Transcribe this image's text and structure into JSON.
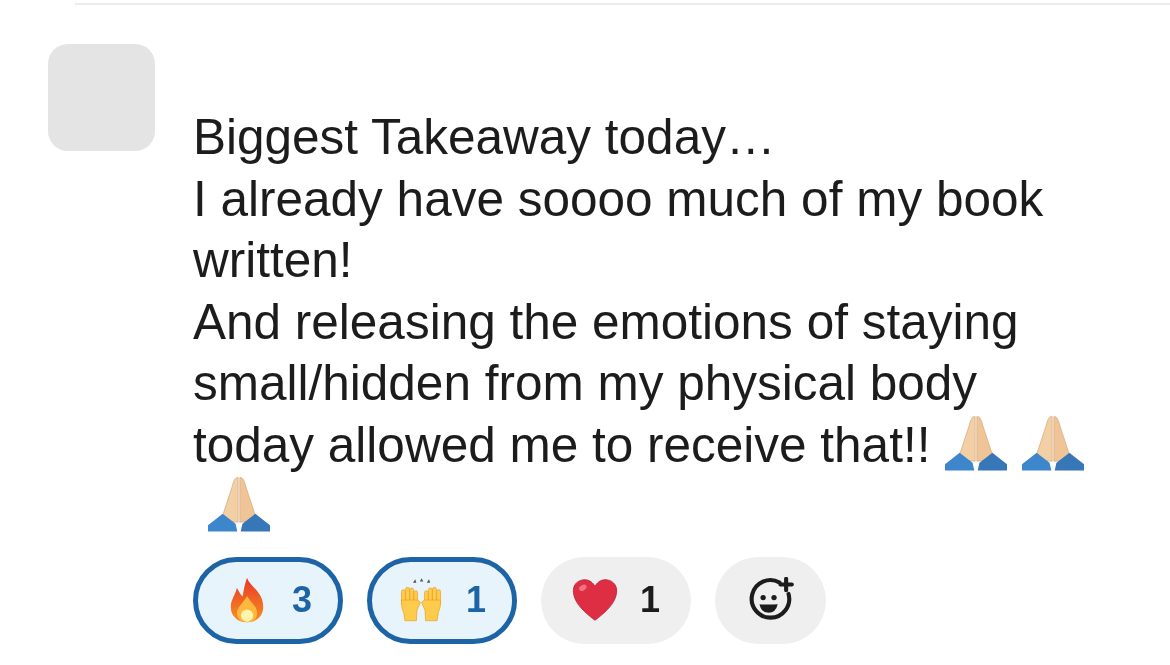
{
  "message": {
    "lines": [
      "Biggest Takeaway today…",
      "I already have soooo much of my book written!",
      "And releasing the emotions of staying small/hidden from my physical body today allowed me to receive that!!"
    ],
    "emoji": [
      {
        "kind": "pray"
      },
      {
        "kind": "pray"
      },
      {
        "kind": "pray"
      }
    ]
  },
  "reactions": [
    {
      "kind": "fire",
      "count": "3",
      "selected": true
    },
    {
      "kind": "hands",
      "count": "1",
      "selected": true
    },
    {
      "kind": "heart",
      "count": "1",
      "selected": false
    }
  ]
}
